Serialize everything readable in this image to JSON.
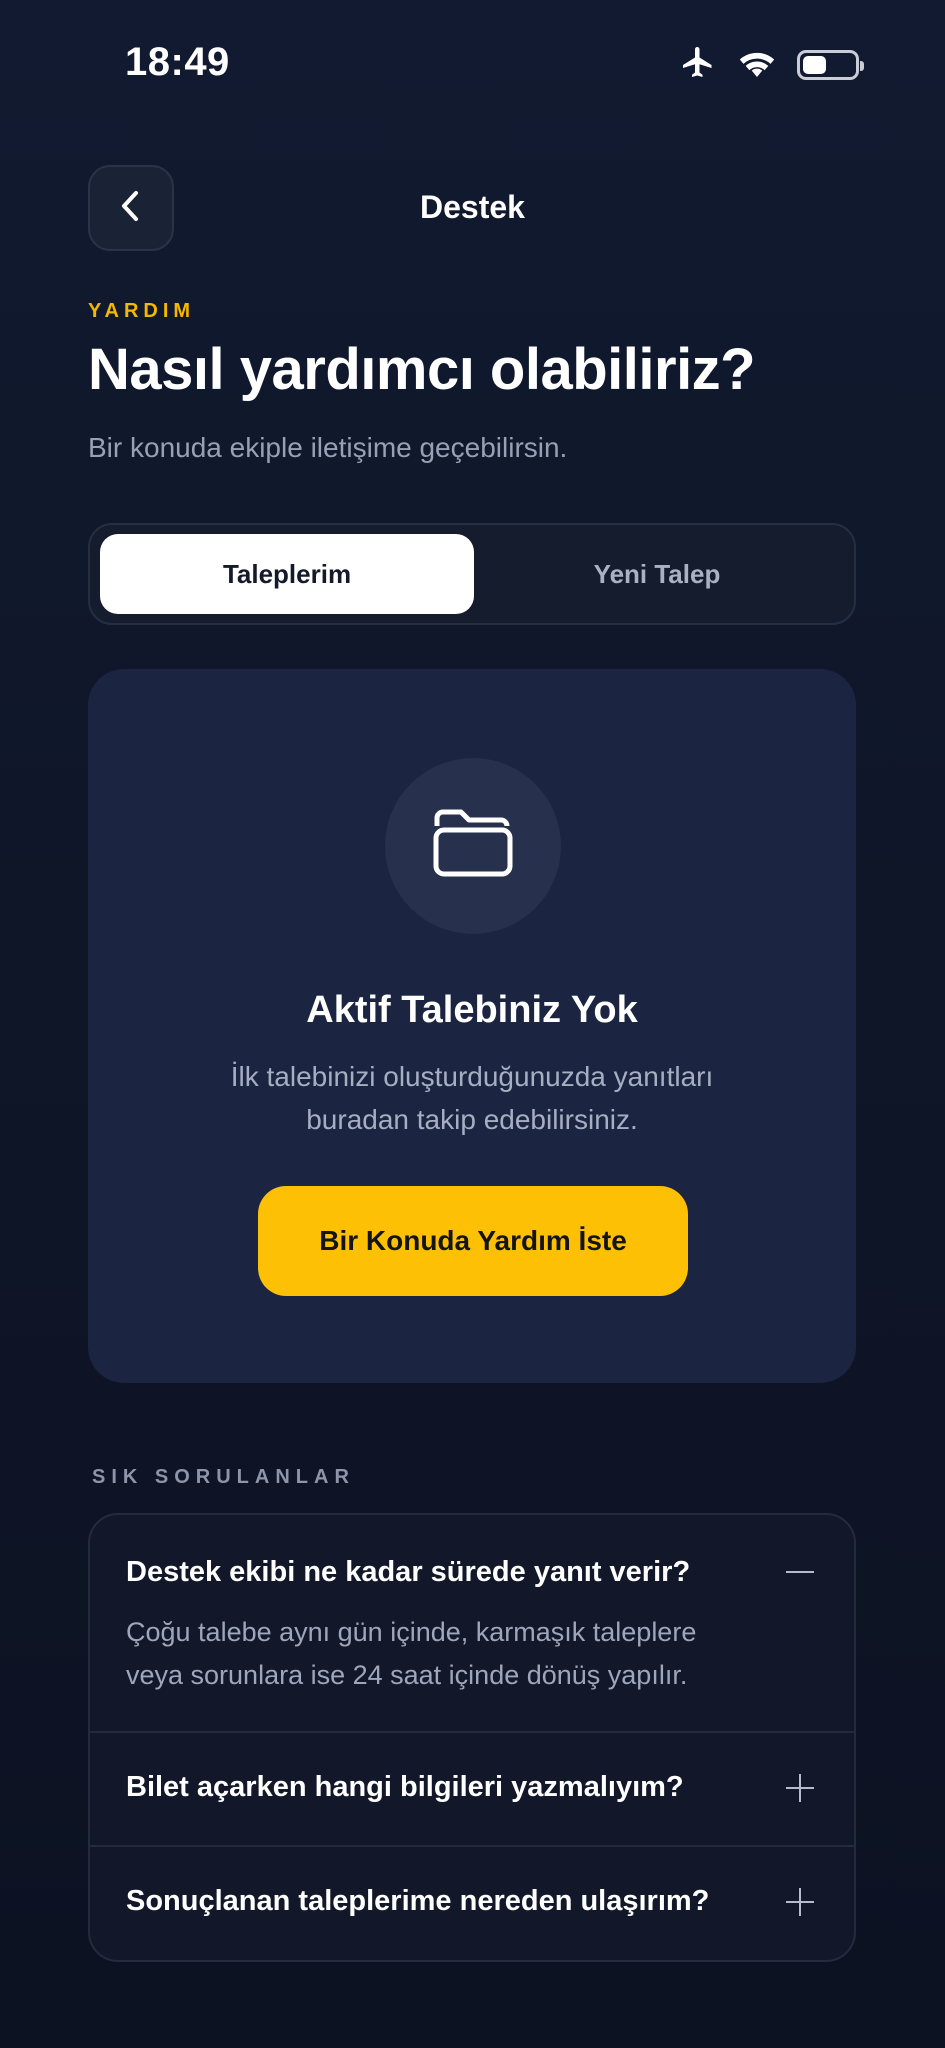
{
  "status_bar": {
    "time": "18:49",
    "icons": [
      "airplane-icon",
      "wifi-icon",
      "battery-icon"
    ],
    "battery_level": 0.45
  },
  "nav": {
    "back_icon": "chevron-left-icon",
    "title": "Destek"
  },
  "header": {
    "eyebrow": "YARDIM",
    "title": "Nasıl yardımcı olabiliriz?",
    "subtitle": "Bir konuda ekiple iletişime geçebilirsin."
  },
  "tabs": [
    {
      "label": "Taleplerim",
      "active": true
    },
    {
      "label": "Yeni Talep",
      "active": false
    }
  ],
  "empty_state": {
    "icon": "folder-icon",
    "title": "Aktif Talebiniz Yok",
    "description_line1": "İlk talebinizi oluşturduğunuzda yanıtları",
    "description_line2": "buradan takip edebilirsiniz.",
    "cta_label": "Bir Konuda Yardım İste"
  },
  "faq": {
    "heading": "SIK SORULANLAR",
    "items": [
      {
        "question": "Destek ekibi ne kadar sürede yanıt verir?",
        "answer_line1": "Çoğu talebe aynı gün içinde, karmaşık taleplere",
        "answer_line2": "veya sorunlara ise 24 saat içinde dönüş yapılır.",
        "expanded": true,
        "toggle_icon": "minus-icon"
      },
      {
        "question": "Bilet açarken hangi bilgileri yazmalıyım?",
        "expanded": false,
        "toggle_icon": "plus-icon"
      },
      {
        "question": "Sonuçlanan taleplerime nereden ulaşırım?",
        "expanded": false,
        "toggle_icon": "plus-icon"
      }
    ]
  },
  "colors": {
    "background": "#0f1628",
    "card": "#1b2541",
    "accent": "#fec004",
    "eyebrow": "#f5b800"
  }
}
